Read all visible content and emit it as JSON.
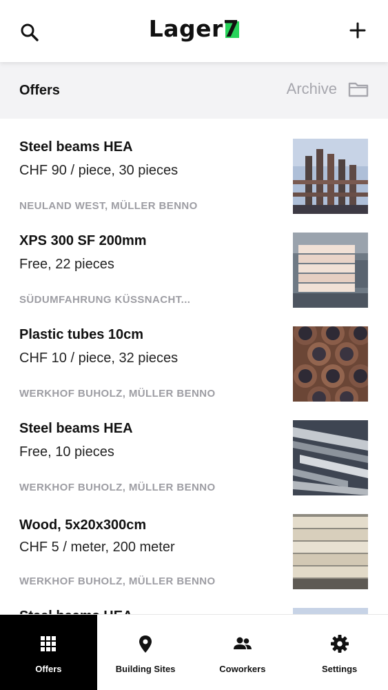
{
  "header": {
    "logo_text": "Lager7",
    "logo_accent_color": "#27d35a",
    "search_icon": "search-icon",
    "add_icon": "plus-icon"
  },
  "section": {
    "title": "Offers",
    "archive_label": "Archive",
    "archive_icon": "folder-icon"
  },
  "offers": [
    {
      "title": "Steel beams HEA",
      "price": "CHF 90 / piece, 30 pieces",
      "meta": "NEULAND WEST, MÜLLER BENNO",
      "thumbnail": "steel-beams-photo"
    },
    {
      "title": "XPS 300 SF 200mm",
      "price": "Free, 22 pieces",
      "meta": "SÜDUMFAHRUNG KÜSSNACHT...",
      "thumbnail": "insulation-boards-photo"
    },
    {
      "title": "Plastic tubes 10cm",
      "price": "CHF 10 / piece, 32 pieces",
      "meta": "WERKHOF BUHOLZ, MÜLLER BENNO",
      "thumbnail": "plastic-tubes-photo"
    },
    {
      "title": "Steel beams HEA",
      "price": "Free, 10 pieces",
      "meta": "WERKHOF BUHOLZ, MÜLLER BENNO",
      "thumbnail": "steel-profiles-photo"
    },
    {
      "title": "Wood, 5x20x300cm",
      "price": "CHF 5 / meter, 200 meter",
      "meta": "WERKHOF BUHOLZ, MÜLLER BENNO",
      "thumbnail": "wood-planks-photo"
    },
    {
      "title": "Steel beams HEA",
      "price": "",
      "meta": "",
      "thumbnail": "steel-beams-photo"
    }
  ],
  "tabs": [
    {
      "label": "Offers",
      "icon": "grid-icon",
      "active": true
    },
    {
      "label": "Building Sites",
      "icon": "map-pin-icon",
      "active": false
    },
    {
      "label": "Coworkers",
      "icon": "people-icon",
      "active": false
    },
    {
      "label": "Settings",
      "icon": "gear-icon",
      "active": false
    }
  ]
}
